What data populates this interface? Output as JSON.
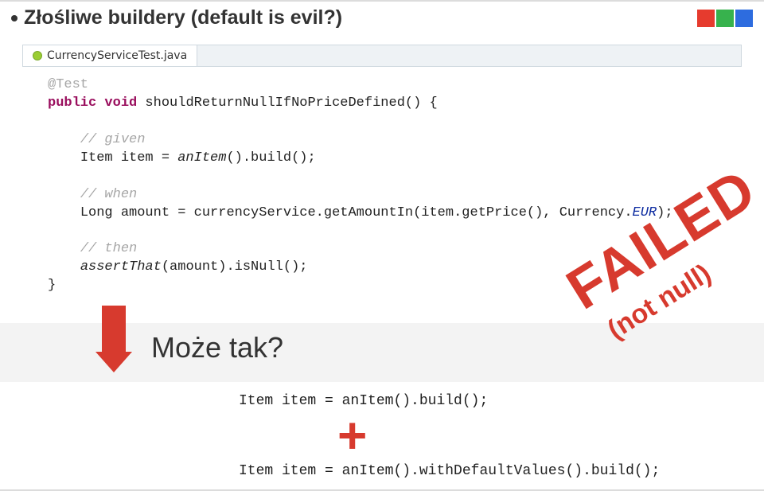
{
  "title": "Złośliwe buildery (default is evil?)",
  "tab": {
    "filename": "CurrencyServiceTest.java"
  },
  "code": {
    "annotation": "@Test",
    "sig_kw1": "public",
    "sig_kw2": "void",
    "sig_rest": " shouldReturnNullIfNoPriceDefined() {",
    "given_c": "// given",
    "given_line": "Item item = ",
    "given_call": "anItem",
    "given_tail": "().build();",
    "when_c": "// when",
    "when_line_a": "Long amount = currencyService.getAmountIn(item.getPrice(), Currency.",
    "when_enum": "EUR",
    "when_tail": ");",
    "then_c": "// then",
    "then_call": "assertThat",
    "then_rest": "(amount).isNull();",
    "close": "}"
  },
  "maybe_label": "Może tak?",
  "failed_label": "FAILED",
  "notnull_label": "(not null)",
  "alt1": "Item item = anItem().build();",
  "plus": "+",
  "alt2": "Item item = anItem().withDefaultValues().build();"
}
